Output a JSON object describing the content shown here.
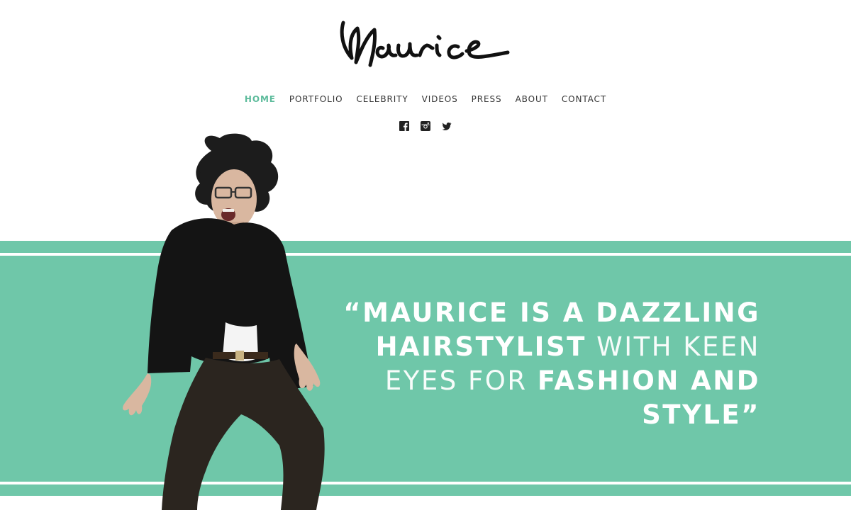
{
  "brand": {
    "logo_text": "Maurice"
  },
  "nav": {
    "items": [
      {
        "label": "HOME",
        "active": true
      },
      {
        "label": "PORTFOLIO",
        "active": false
      },
      {
        "label": "CELEBRITY",
        "active": false
      },
      {
        "label": "VIDEOS",
        "active": false
      },
      {
        "label": "PRESS",
        "active": false
      },
      {
        "label": "ABOUT",
        "active": false
      },
      {
        "label": "CONTACT",
        "active": false
      }
    ]
  },
  "social": {
    "icons": [
      "facebook-icon",
      "instagram-icon",
      "twitter-icon"
    ]
  },
  "hero": {
    "quote_parts": [
      "“MAURICE IS A DAZZLING",
      "HAIRSTYLIST",
      "WITH KEEN",
      "EYES FOR",
      "FASHION AND",
      "STYLE”"
    ]
  },
  "colors": {
    "accent": "#5cbb9b",
    "band": "#6fc7a9",
    "text": "#333333"
  }
}
